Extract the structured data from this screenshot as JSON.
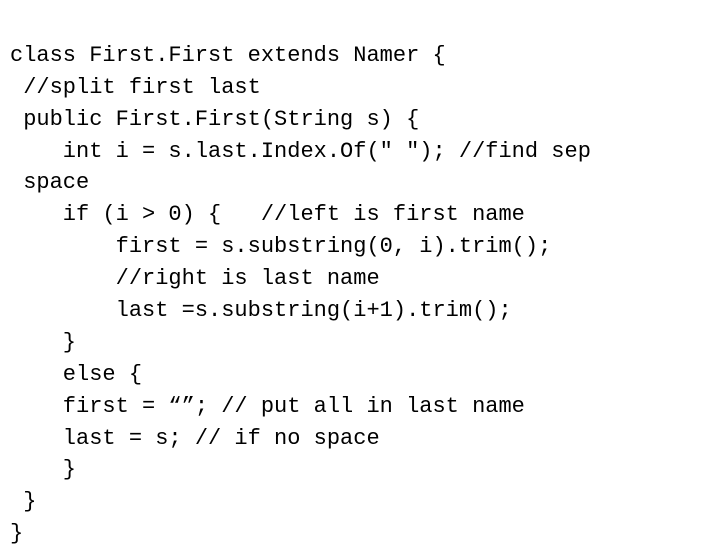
{
  "code": {
    "lines": [
      "class First.First extends Namer {",
      " //split first last",
      " public First.First(String s) {",
      "    int i = s.last.Index.Of(\" \"); //find sep",
      " space",
      "    if (i > 0) {   //left is first name",
      "        first = s.substring(0, i).trim();",
      "        //right is last name",
      "        last =s.substring(i+1).trim();",
      "    }",
      "    else {",
      "    first = “”; // put all in last name",
      "    last = s; // if no space",
      "    }",
      " }",
      "}"
    ]
  }
}
